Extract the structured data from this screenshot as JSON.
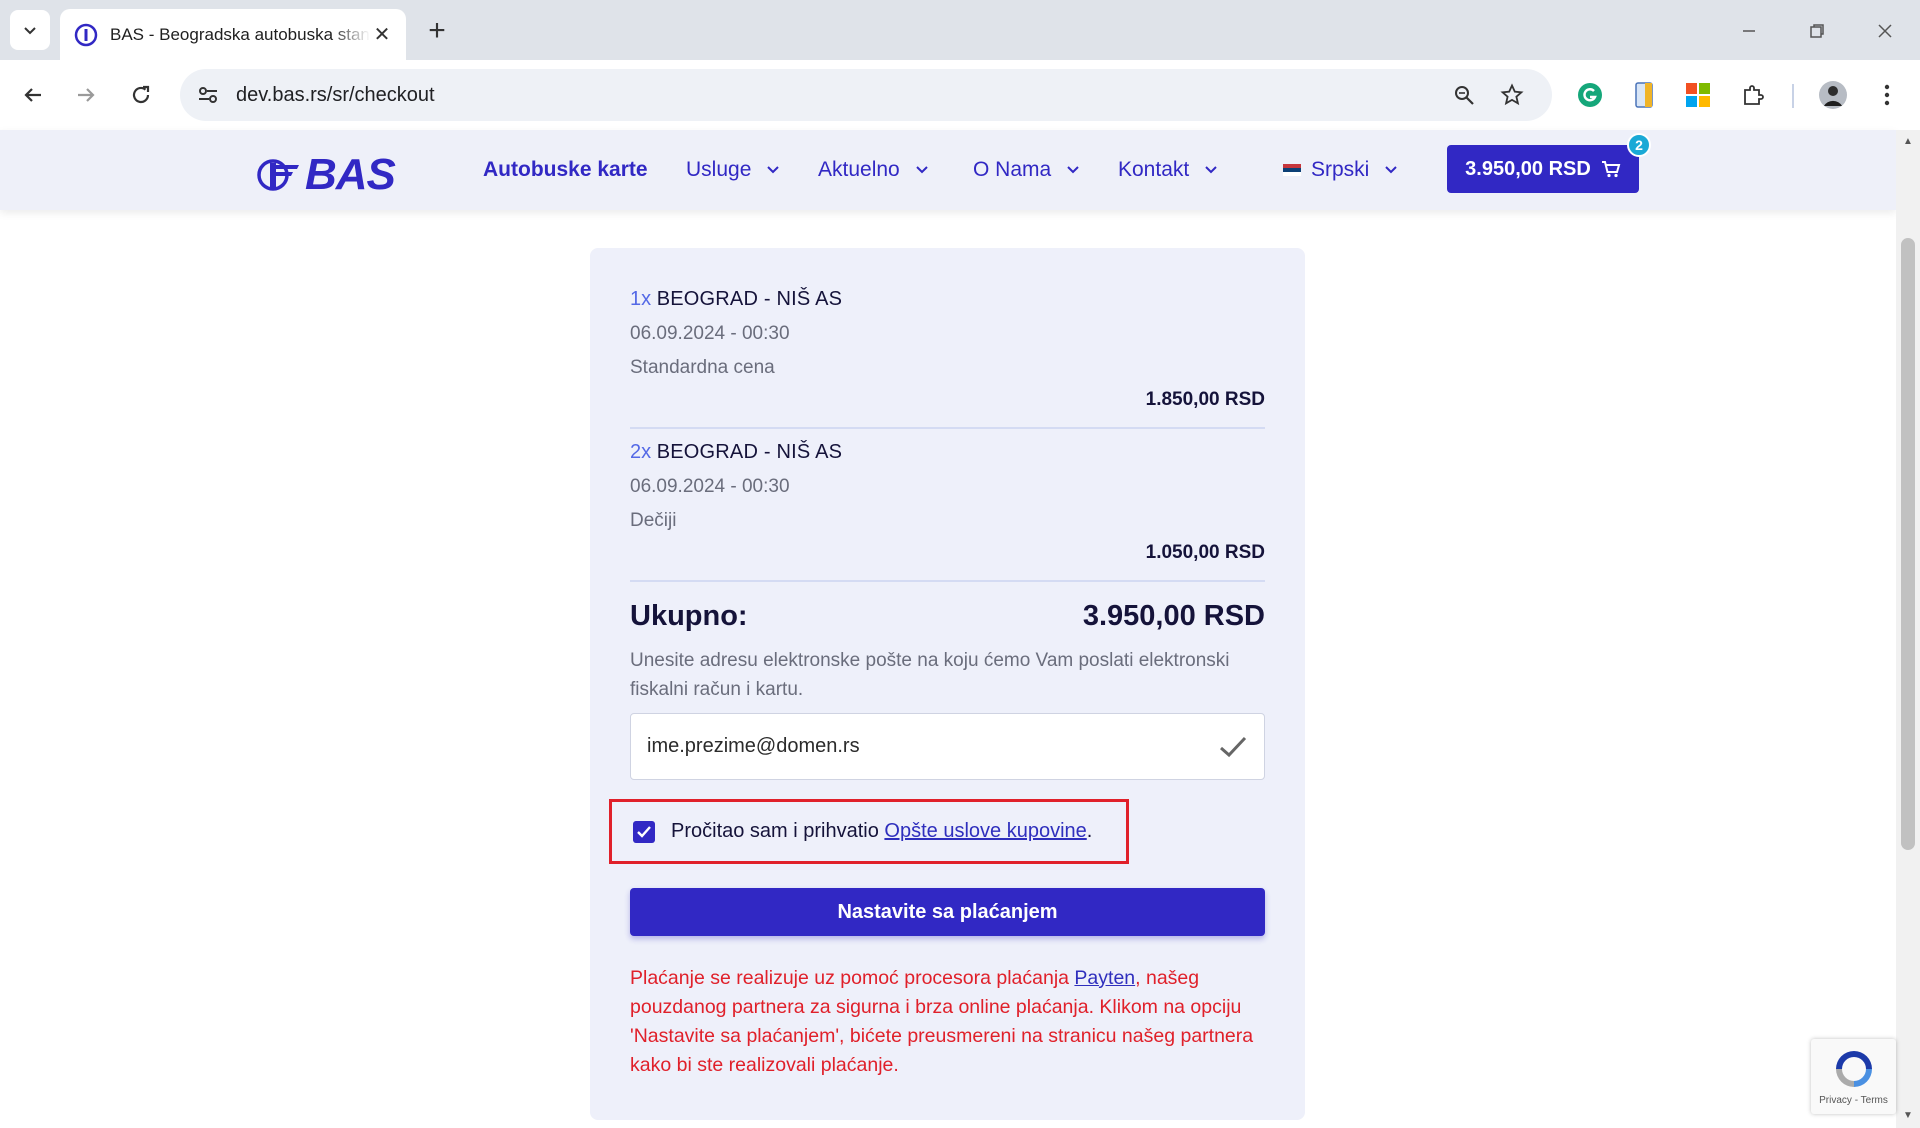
{
  "browser": {
    "tab_title": "BAS - Beogradska autobuska stanica",
    "new_tab_symbol": "+",
    "url": "dev.bas.rs/sr/checkout"
  },
  "header": {
    "logo_text": "BAS",
    "nav": [
      {
        "label": "Autobuske karte",
        "has_dropdown": false
      },
      {
        "label": "Usluge",
        "has_dropdown": true
      },
      {
        "label": "Aktuelno",
        "has_dropdown": true
      },
      {
        "label": "O Nama",
        "has_dropdown": true
      },
      {
        "label": "Kontakt",
        "has_dropdown": true
      }
    ],
    "language": "Srpski",
    "cart_total": "3.950,00 RSD",
    "cart_count": "2"
  },
  "order": {
    "items": [
      {
        "qty": "1x",
        "route": "BEOGRAD - NIŠ AS",
        "datetime": "06.09.2024 - 00:30",
        "fare": "Standardna cena",
        "price": "1.850,00 RSD"
      },
      {
        "qty": "2x",
        "route": "BEOGRAD - NIŠ AS",
        "datetime": "06.09.2024 - 00:30",
        "fare": "Dečiji",
        "price": "1.050,00 RSD"
      }
    ],
    "total_label": "Ukupno:",
    "total_value": "3.950,00 RSD",
    "email_note": "Unesite adresu elektronske pošte na koju ćemo Vam poslati elektronski fiskalni račun i kartu.",
    "email_value": "ime.prezime@domen.rs",
    "terms_text": "Pročitao sam i prihvatio ",
    "terms_link": "Opšte uslove kupovine",
    "terms_suffix": ".",
    "terms_checked": true,
    "pay_button": "Nastavite sa plaćanjem",
    "payten_prefix": "Plaćanje se realizuje uz pomoć procesora plaćanja ",
    "payten_link": "Payten",
    "payten_suffix": ", našeg pouzdanog partnera za sigurna i brza online plaćanja. Klikom na opciju 'Nastavite sa plaćanjem', bićete preusmereni na stranicu našeg partnera kako bi ste realizovali plaćanje."
  },
  "recaptcha": {
    "text": "Privacy - Terms"
  },
  "colors": {
    "brand": "#3128c4",
    "warning": "#e0202a",
    "badge": "#1aa9d6"
  }
}
